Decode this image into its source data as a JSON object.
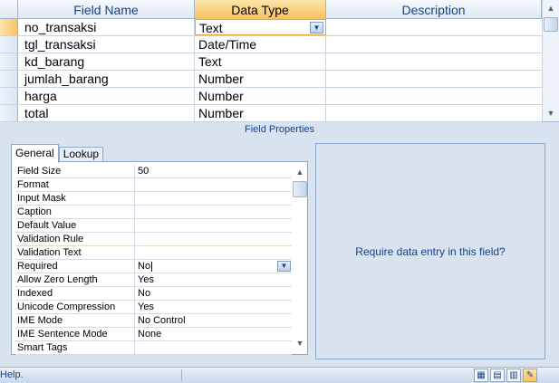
{
  "grid": {
    "headers": {
      "field_name": "Field Name",
      "data_type": "Data Type",
      "description": "Description"
    },
    "rows": [
      {
        "field": "no_transaksi",
        "type": "Text",
        "desc": ""
      },
      {
        "field": "tgl_transaksi",
        "type": "Date/Time",
        "desc": ""
      },
      {
        "field": "kd_barang",
        "type": "Text",
        "desc": ""
      },
      {
        "field": "jumlah_barang",
        "type": "Number",
        "desc": ""
      },
      {
        "field": "harga",
        "type": "Number",
        "desc": ""
      },
      {
        "field": "total",
        "type": "Number",
        "desc": ""
      }
    ]
  },
  "field_properties": {
    "title": "Field Properties",
    "tabs": [
      "General",
      "Lookup"
    ],
    "properties": [
      {
        "name": "Field Size",
        "value": "50"
      },
      {
        "name": "Format",
        "value": ""
      },
      {
        "name": "Input Mask",
        "value": ""
      },
      {
        "name": "Caption",
        "value": ""
      },
      {
        "name": "Default Value",
        "value": ""
      },
      {
        "name": "Validation Rule",
        "value": ""
      },
      {
        "name": "Validation Text",
        "value": ""
      },
      {
        "name": "Required",
        "value": "No"
      },
      {
        "name": "Allow Zero Length",
        "value": "Yes"
      },
      {
        "name": "Indexed",
        "value": "No"
      },
      {
        "name": "Unicode Compression",
        "value": "Yes"
      },
      {
        "name": "IME Mode",
        "value": "No Control"
      },
      {
        "name": "IME Sentence Mode",
        "value": "None"
      },
      {
        "name": "Smart Tags",
        "value": ""
      }
    ],
    "hint": "Require data entry in this field?"
  },
  "statusbar": {
    "text": "Help.",
    "view_buttons": [
      "datasheet-view",
      "pivot-table-view",
      "pivot-chart-view",
      "design-view"
    ]
  },
  "colors": {
    "accent": "#f7c25e",
    "header_text": "#15428b",
    "pane": "#d9e3f0"
  }
}
